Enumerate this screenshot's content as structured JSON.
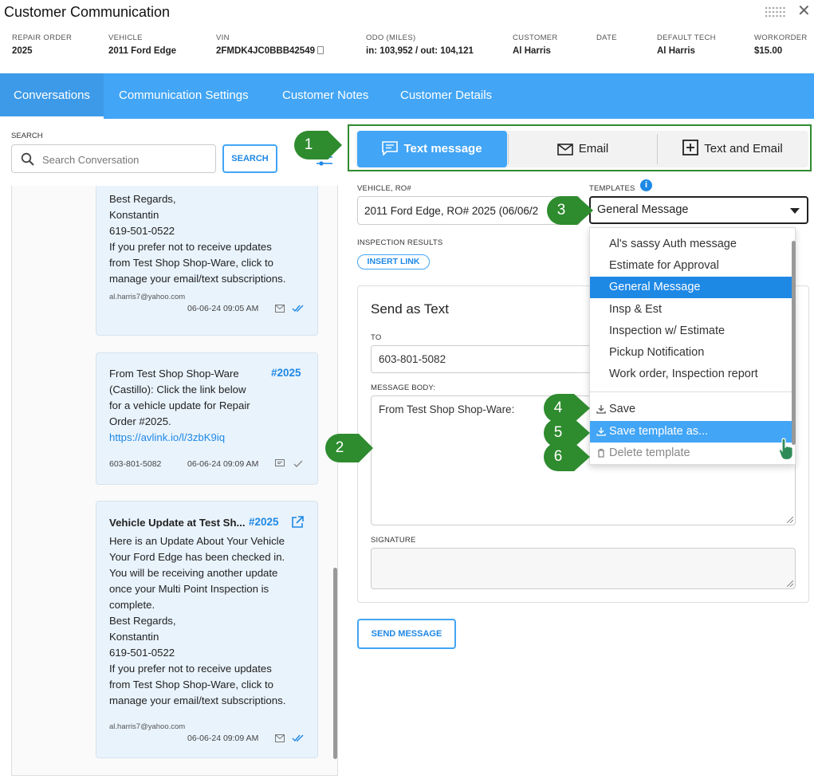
{
  "window": {
    "title": "Customer Communication"
  },
  "header": {
    "fields": [
      {
        "label": "REPAIR ORDER",
        "value": "2025"
      },
      {
        "label": "VEHICLE",
        "value": "2011 Ford Edge"
      },
      {
        "label": "VIN",
        "value": "2FMDK4JC0BBB42549"
      },
      {
        "label": "ODO (MILES)",
        "value": "in: 103,952 / out: 104,121"
      },
      {
        "label": "CUSTOMER",
        "value": "Al Harris"
      },
      {
        "label": "DATE",
        "value": ""
      },
      {
        "label": "DEFAULT TECH",
        "value": "Al Harris"
      },
      {
        "label": "WORKORDER",
        "value": "$15.00"
      }
    ]
  },
  "nav": {
    "tabs": [
      {
        "label": "Conversations"
      },
      {
        "label": "Communication Settings"
      },
      {
        "label": "Customer Notes"
      },
      {
        "label": "Customer Details"
      }
    ]
  },
  "search": {
    "label": "SEARCH",
    "placeholder": "Search Conversation",
    "button": "SEARCH"
  },
  "messages": [
    {
      "body": "Best Regards,\nKonstantin\n619-501-0522\nIf you prefer not to receive updates\nfrom Test Shop Shop-Ware, click to\nmanage your email/text subscriptions.",
      "email": "al.harris7@yahoo.com",
      "time": "06-06-24 09:05 AM"
    },
    {
      "body_text": "From Test Shop Shop-Ware\n(Castillo): Click the link below\nfor a vehicle update for Repair\nOrder #2025.",
      "link": "https://avlink.io/l/3zbK9iq",
      "ro": "#2025",
      "phone": "603-801-5082",
      "time": "06-06-24 09:09 AM"
    },
    {
      "heading": "Vehicle Update at Test Sh...",
      "ro": "#2025",
      "body": "Here is an Update About Your Vehicle\nYour Ford Edge has been checked in.\nYou will be receiving another update\nonce your Multi Point Inspection is\ncomplete.\nBest Regards,\nKonstantin\n619-501-0522\nIf you prefer not to receive updates\nfrom Test Shop Shop-Ware, click to\nmanage your email/text subscriptions.",
      "email": "al.harris7@yahoo.com",
      "time": "06-06-24 09:09 AM"
    }
  ],
  "message_types": [
    {
      "label": "Text message",
      "active": true
    },
    {
      "label": "Email",
      "active": false
    },
    {
      "label": "Text and Email",
      "active": false
    }
  ],
  "compose": {
    "vehicle_label": "VEHICLE, RO#",
    "vehicle_value": "2011 Ford Edge, RO# 2025 (06/06/2",
    "templates_label": "TEMPLATES",
    "template_selected": "General Message",
    "inspection_label": "INSPECTION RESULTS",
    "insert_link": "INSERT LINK",
    "card_title": "Send as Text",
    "to_label": "TO",
    "to_value": "603-801-5082",
    "body_label": "MESSAGE BODY:",
    "body_value": "From Test Shop Shop-Ware:",
    "signature_label": "SIGNATURE",
    "send_button": "SEND MESSAGE"
  },
  "template_menu": {
    "items": [
      "Al's sassy Auth message",
      "Estimate for Approval",
      "General Message",
      "Insp & Est",
      "Inspection w/ Estimate",
      "Pickup Notification",
      "Work order, Inspection report"
    ],
    "selected": "General Message",
    "actions": [
      {
        "label": "Save",
        "icon": "download-icon"
      },
      {
        "label": "Save template as...",
        "icon": "download-icon"
      },
      {
        "label": "Delete template",
        "icon": "trash-icon"
      }
    ]
  },
  "callouts": [
    "1",
    "2",
    "3",
    "4",
    "5",
    "6"
  ],
  "colors": {
    "accent": "#42a5f5",
    "callout": "#2e8b2e",
    "selected": "#1e88e5"
  }
}
